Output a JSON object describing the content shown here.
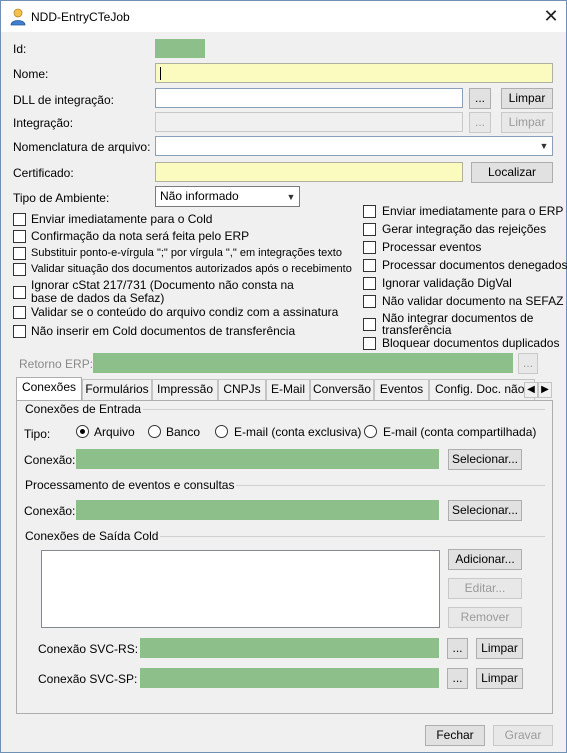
{
  "window": {
    "title": "NDD-EntryCTeJob",
    "close_glyph": "✕"
  },
  "fields": {
    "id_label": "Id:",
    "nome_label": "Nome:",
    "dll_label": "DLL de integração:",
    "integracao_label": "Integração:",
    "nomenclatura_label": "Nomenclatura de arquivo:",
    "certificado_label": "Certificado:",
    "tipo_ambiente_label": "Tipo de Ambiente:",
    "tipo_ambiente_value": "Não informado",
    "retorno_erp_label": "Retorno ERP:"
  },
  "buttons": {
    "ellipsis": "...",
    "limpar": "Limpar",
    "localizar": "Localizar",
    "selecionar": "Selecionar...",
    "adicionar": "Adicionar...",
    "editar": "Editar...",
    "remover": "Remover",
    "fechar": "Fechar",
    "gravar": "Gravar"
  },
  "checkboxes_left": [
    "Enviar imediatamente para o Cold",
    "Confirmação da nota será feita pelo ERP",
    "Substituir ponto-e-vírgula \";\" por vírgula \",\" em integrações texto",
    "Validar situação dos documentos autorizados após o recebimento",
    "Ignorar cStat 217/731 (Documento não consta na",
    "base de dados da Sefaz)",
    "Validar se o conteúdo do arquivo condiz com a assinatura",
    "Não inserir em Cold documentos de transferência"
  ],
  "checkboxes_right": [
    "Enviar imediatamente para o ERP",
    "Gerar integração das rejeições",
    "Processar eventos",
    "Processar documentos denegados",
    "Ignorar validação DigVal",
    "Não validar documento na SEFAZ",
    "Não integrar documentos de",
    "transferência",
    "Bloquear documentos duplicados"
  ],
  "tabs": [
    "Conexões",
    "Formulários",
    "Impressão",
    "CNPJs",
    "E-Mail",
    "Conversão",
    "Eventos",
    "Config. Doc. não"
  ],
  "tab_arrows": {
    "left": "◀",
    "right": "▶"
  },
  "conexoes": {
    "entrada_title": "Conexões de Entrada",
    "tipo_label": "Tipo:",
    "radio_options": [
      "Arquivo",
      "Banco",
      "E-mail (conta exclusiva)",
      "E-mail (conta compartilhada)"
    ],
    "selected_radio": "Arquivo",
    "conexao_label": "Conexão:",
    "processamento_title": "Processamento de eventos e consultas",
    "saida_title": "Conexões de Saída Cold",
    "svc_rs_label": "Conexão SVC-RS:",
    "svc_sp_label": "Conexão SVC-SP:"
  },
  "colors": {
    "green_field": "#8dbf8a",
    "yellow_field": "#fbfbc0"
  },
  "icons": {
    "app": "user-icon",
    "dropdown": "chevron-down-icon"
  }
}
